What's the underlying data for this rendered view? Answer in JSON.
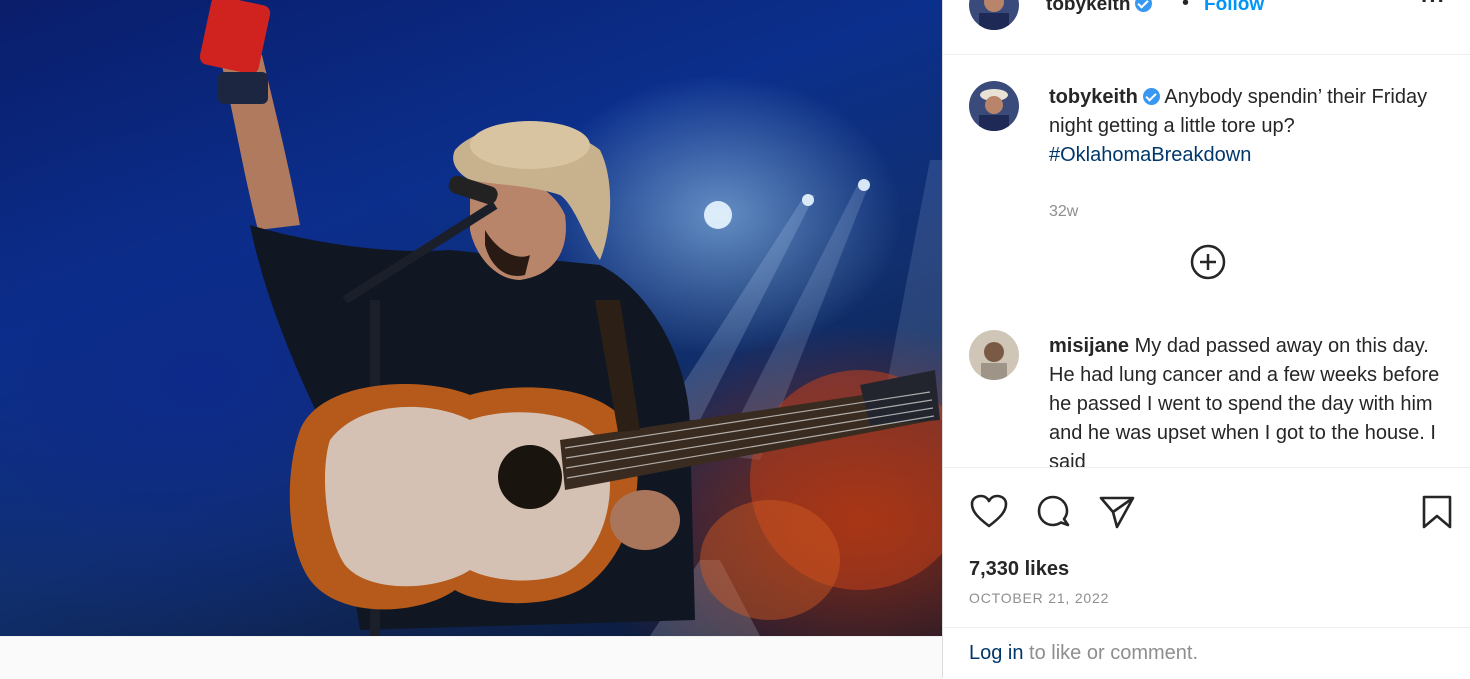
{
  "post": {
    "username": "tobykeith",
    "follow_label": "Follow",
    "separator": "•",
    "more_label": "···",
    "caption": "Anybody spendin’ their Friday night getting a little tore up?",
    "hashtag": "#OklahomaBreakdown",
    "age": "32w",
    "likes": "7,330 likes",
    "date": "OCTOBER 21, 2022"
  },
  "comments": [
    {
      "username": "misijane",
      "text": "My dad passed away on this day. He had lung cancer and a few weeks before he passed I went to spend the day with him and he was upset when I got to the house. I said"
    }
  ],
  "footer": {
    "login_link": "Log in",
    "login_rest": " to like or comment."
  },
  "icons": {
    "like": "heart-icon",
    "comment": "comment-icon",
    "share": "share-icon",
    "save": "bookmark-icon",
    "load_more": "plus-circle-icon"
  },
  "colors": {
    "link": "#0095f6",
    "hashtag": "#00376b",
    "verified": "#3897f0",
    "muted": "#8e8e8e"
  }
}
